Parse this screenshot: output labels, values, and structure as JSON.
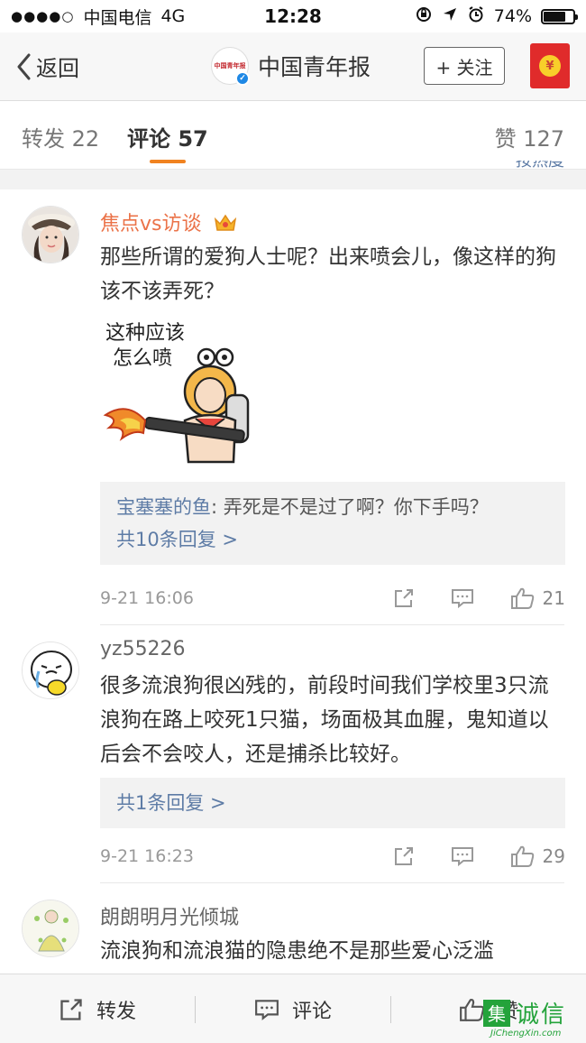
{
  "status_bar": {
    "signal": "●●●●○",
    "carrier": "中国电信",
    "network": "4G",
    "time": "12:28",
    "battery": "74%",
    "battery_level": 0.74
  },
  "nav": {
    "back_label": "返回",
    "title": "中国青年报",
    "avatar_text": "中国青年报",
    "follow_label": "+ 关注",
    "redpack_symbol": "¥"
  },
  "tabs": {
    "repost": "转发 22",
    "comment": "评论 57",
    "like": "赞 127",
    "sort_peek": "按热度"
  },
  "comments": [
    {
      "user": "焦点vs访谈",
      "vip": true,
      "text": "那些所谓的爱狗人士呢？出来喷会儿，像这样的狗该不该弄死？",
      "sticker_text_line1": "这种应该",
      "sticker_text_line2": "怎么喷",
      "reply_user": "宝塞塞的鱼",
      "reply_text": ": 弄死是不是过了啊？你下手吗？",
      "reply_more": "共10条回复 >",
      "time": "9-21 16:06",
      "likes": "21"
    },
    {
      "user": "yz55226",
      "vip": false,
      "text": "很多流浪狗很凶残的，前段时间我们学校里3只流浪狗在路上咬死1只猫，场面极其血腥，鬼知道以后会不会咬人，还是捕杀比较好。",
      "reply_more": "共1条回复 >",
      "time": "9-21 16:23",
      "likes": "29"
    },
    {
      "user": "朗朗明月光倾城",
      "vip": false,
      "text": "流浪狗和流浪猫的隐患绝不是那些爱心泛滥"
    }
  ],
  "toolbar": {
    "repost": "转发",
    "comment": "评论",
    "like": "赞"
  },
  "watermark": {
    "box": "集",
    "text": "诚信",
    "url": "JiChengXin.com"
  },
  "colors": {
    "accent_orange": "#f08220",
    "link_blue": "#5e7ca6",
    "vip_name": "#eb7349",
    "redpack": "#e02b2b",
    "watermark_green": "#24a33b"
  }
}
